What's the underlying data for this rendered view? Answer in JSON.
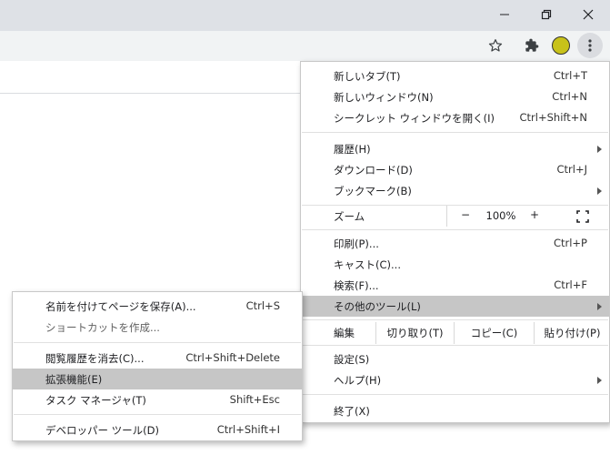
{
  "window": {
    "minimize_glyph": "—",
    "maximize_glyph": "❐",
    "close_glyph": "✕"
  },
  "toolbar": {
    "bookmark_icon": "star-icon",
    "extensions_icon": "puzzle-icon",
    "profile_color": "#c8c21a",
    "menu_icon": "three-dots-icon"
  },
  "main_menu": {
    "new_tab": {
      "label": "新しいタブ(T)",
      "shortcut": "Ctrl+T"
    },
    "new_window": {
      "label": "新しいウィンドウ(N)",
      "shortcut": "Ctrl+N"
    },
    "incognito": {
      "label": "シークレット ウィンドウを開く(I)",
      "shortcut": "Ctrl+Shift+N"
    },
    "history": {
      "label": "履歴(H)"
    },
    "downloads": {
      "label": "ダウンロード(D)",
      "shortcut": "Ctrl+J"
    },
    "bookmarks": {
      "label": "ブックマーク(B)"
    },
    "zoom": {
      "label": "ズーム",
      "minus": "−",
      "value": "100%",
      "plus": "+"
    },
    "print": {
      "label": "印刷(P)...",
      "shortcut": "Ctrl+P"
    },
    "cast": {
      "label": "キャスト(C)..."
    },
    "find": {
      "label": "検索(F)...",
      "shortcut": "Ctrl+F"
    },
    "more_tools": {
      "label": "その他のツール(L)"
    },
    "edit": {
      "label": "編集",
      "cut": "切り取り(T)",
      "copy": "コピー(C)",
      "paste": "貼り付け(P)"
    },
    "settings": {
      "label": "設定(S)"
    },
    "help": {
      "label": "ヘルプ(H)"
    },
    "exit": {
      "label": "終了(X)"
    }
  },
  "sub_menu": {
    "save_page": {
      "label": "名前を付けてページを保存(A)...",
      "shortcut": "Ctrl+S"
    },
    "create_shortcut": {
      "label": "ショートカットを作成..."
    },
    "clear_data": {
      "label": "閲覧履歴を消去(C)...",
      "shortcut": "Ctrl+Shift+Delete"
    },
    "extensions": {
      "label": "拡張機能(E)"
    },
    "task_manager": {
      "label": "タスク マネージャ(T)",
      "shortcut": "Shift+Esc"
    },
    "devtools": {
      "label": "デベロッパー ツール(D)",
      "shortcut": "Ctrl+Shift+I"
    }
  }
}
